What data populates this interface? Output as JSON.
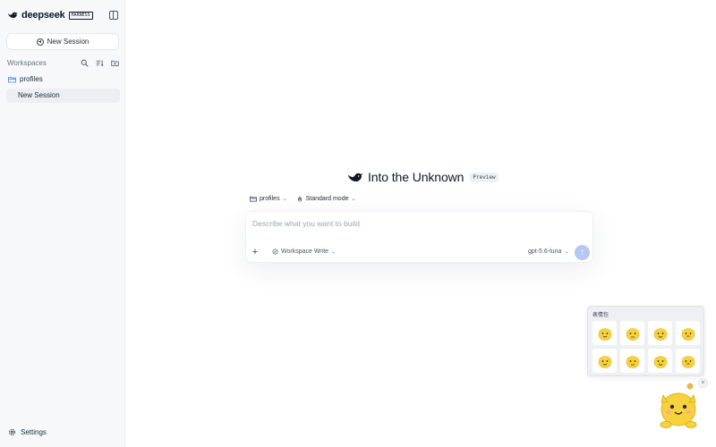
{
  "brand": {
    "name": "deepseek",
    "tag": "HARNESS"
  },
  "sidebar": {
    "new_session_label": "New Session",
    "workspaces_label": "Workspaces",
    "folder_label": "profiles",
    "session_label": "New Session",
    "settings_label": "Settings"
  },
  "main": {
    "title": "Into the Unknown",
    "badge": "Preview",
    "workspace_selector": "profiles",
    "mode_selector": "Standard mode",
    "composer": {
      "placeholder": "Describe what you want to build",
      "permission": "Workspace Write",
      "model": "gpt-5.6-luna"
    }
  },
  "stickers": {
    "title": "表情包",
    "count": 8
  },
  "colors": {
    "accent": "#b7c7f2",
    "sidebar_bg": "#f7f8fa",
    "brand": "#111827",
    "sticker_yellow": "#f7d23c"
  },
  "icons": {
    "brand": "whale-logo-icon",
    "collapse": "sidebar-toggle-icon",
    "new_session": "plus-circle-icon",
    "search": "search-icon",
    "sort": "sort-icon",
    "new_folder": "new-folder-icon",
    "folder": "folder-icon",
    "settings": "gear-icon",
    "send": "arrow-up-icon"
  }
}
